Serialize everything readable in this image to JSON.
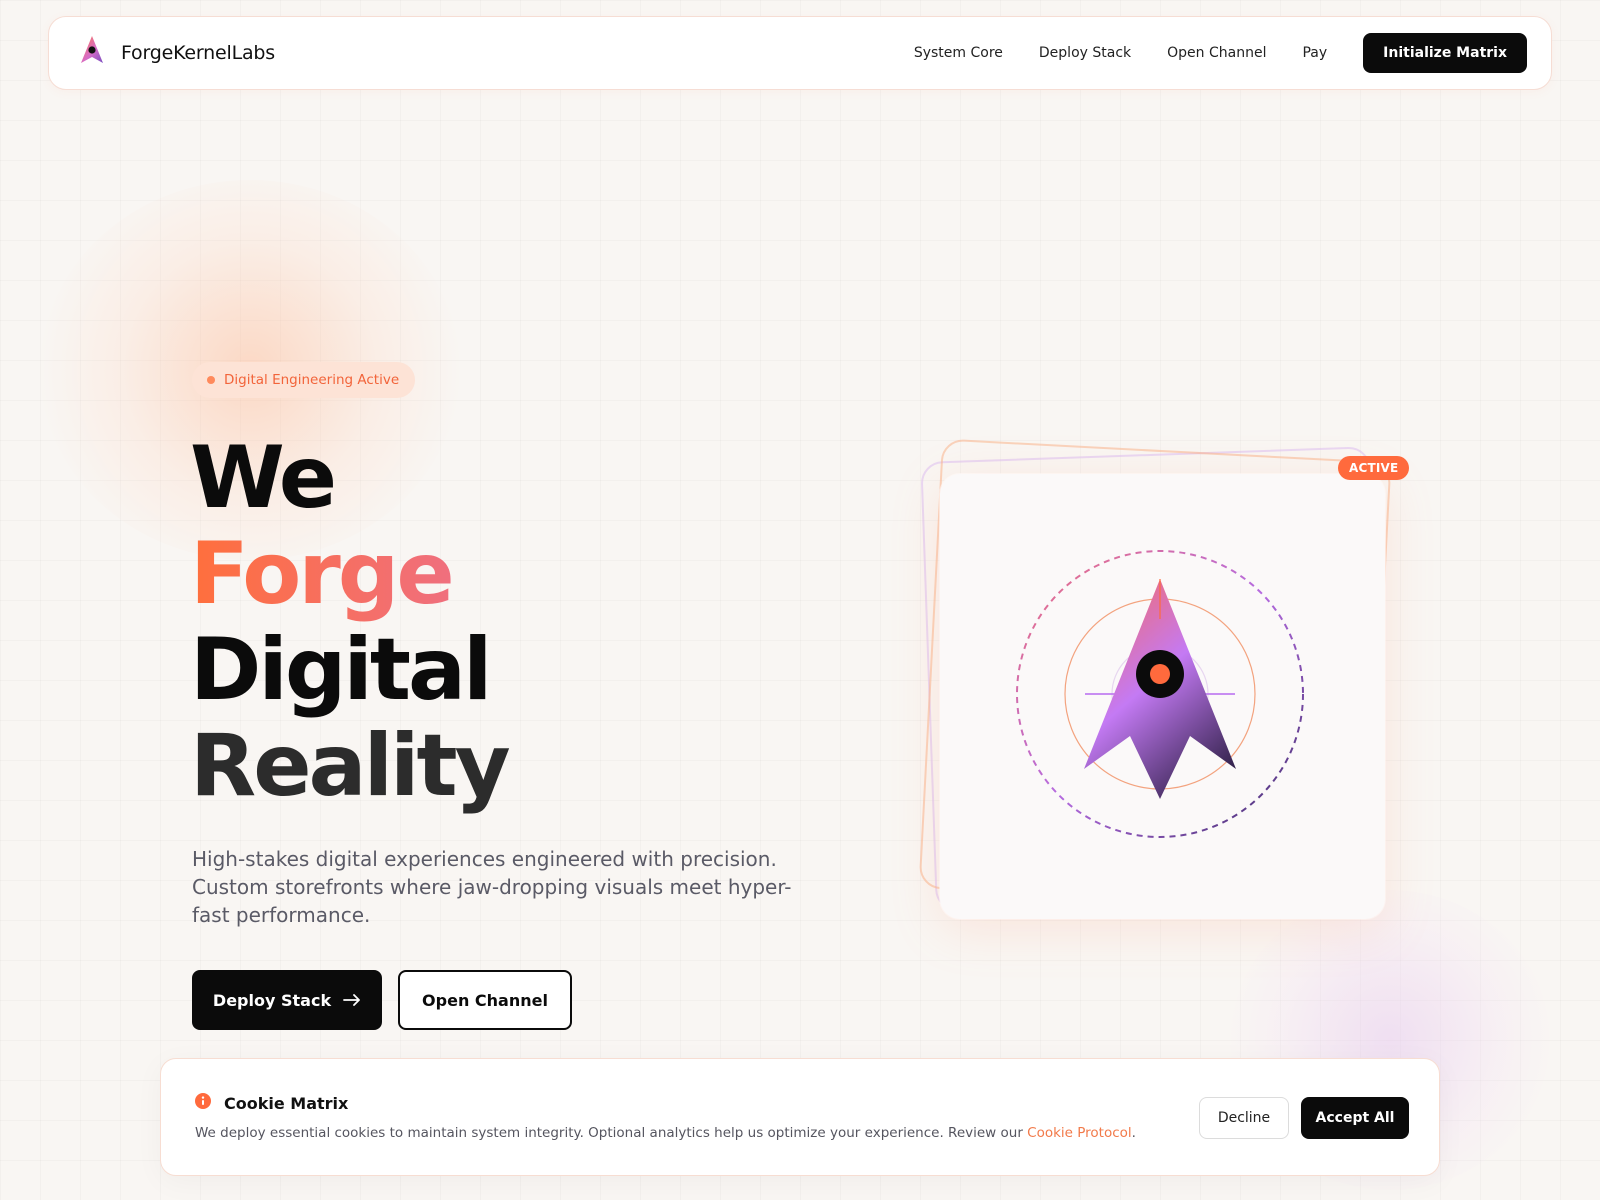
{
  "nav": {
    "brand_name": "ForgeKernelLabs",
    "logo_icon": "rocket-icon",
    "links": [
      "System Core",
      "Deploy Stack",
      "Open Channel",
      "Pay"
    ],
    "cta_label": "Initialize Matrix"
  },
  "hero": {
    "status_pill": "Digital Engineering Active",
    "headline": {
      "line1": "We",
      "line2": "Forge",
      "line3": "Digital",
      "line4": "Reality"
    },
    "description": "High-stakes digital experiences engineered with precision. Custom storefronts where jaw-dropping visuals meet hyper-fast performance.",
    "primary_button": "Deploy Stack",
    "primary_button_icon": "arrow-right-icon",
    "secondary_button": "Open Channel"
  },
  "visual": {
    "badge": "ACTIVE",
    "icon": "rocket-target-icon"
  },
  "cookie": {
    "icon": "info-icon",
    "title": "Cookie Matrix",
    "text": "We deploy essential cookies to maintain system integrity. Optional analytics help us optimize your experience. Review our ",
    "link_text": "Cookie Protocol",
    "text_end": ".",
    "decline_label": "Decline",
    "accept_label": "Accept All"
  },
  "colors": {
    "accent_orange": "#ff6a3d",
    "accent_pink": "#ec6f8c",
    "accent_purple": "#c27cf6",
    "dark": "#0b0b0b",
    "background": "#f9f6f3"
  }
}
